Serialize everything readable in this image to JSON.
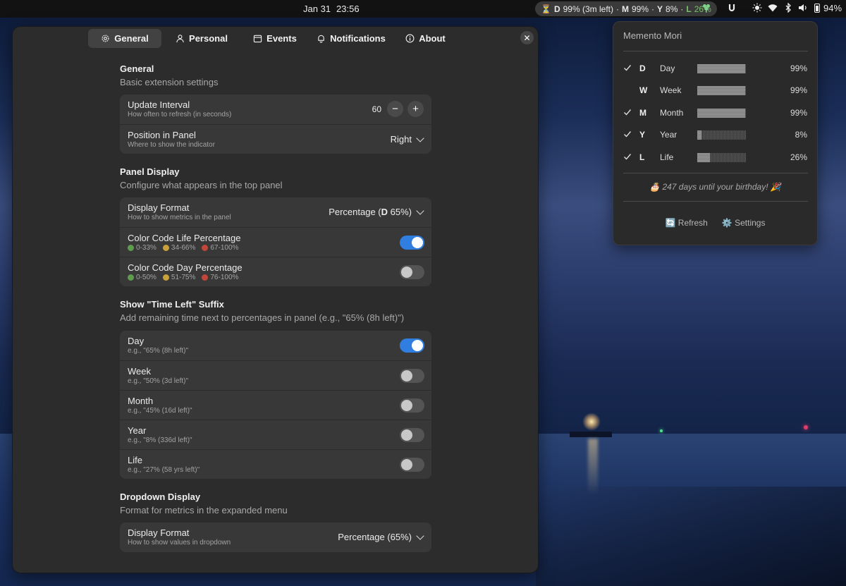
{
  "topbar": {
    "date": "Jan 31",
    "time": "23:56",
    "indicator": {
      "hourglass": "⏳",
      "d_letter": "D",
      "d_value": "99% (3m left)",
      "sep1": "·",
      "m_letter": "M",
      "m_value": "99%",
      "sep2": "·",
      "y_letter": "Y",
      "y_value": "8%",
      "sep3": "·",
      "l_letter": "L",
      "l_value": "26%"
    },
    "battery_level": "94%",
    "tray_icons": [
      "clover-icon",
      "u-app-icon",
      "brightness-icon",
      "wifi-icon",
      "bluetooth-icon",
      "volume-icon",
      "battery-icon"
    ]
  },
  "window": {
    "tabs": [
      {
        "label": "General",
        "icon": "gear-icon",
        "active": true
      },
      {
        "label": "Personal",
        "icon": "person-icon",
        "active": false
      },
      {
        "label": "Events",
        "icon": "calendar-icon",
        "active": false
      },
      {
        "label": "Notifications",
        "icon": "bell-icon",
        "active": false
      },
      {
        "label": "About",
        "icon": "info-icon",
        "active": false
      }
    ],
    "close_label": "✕",
    "general": {
      "title": "General",
      "subtitle": "Basic extension settings",
      "update_interval": {
        "title": "Update Interval",
        "subtitle": "How often to refresh (in seconds)",
        "value": "60",
        "minus": "−",
        "plus": "+"
      },
      "position": {
        "title": "Position in Panel",
        "subtitle": "Where to show the indicator",
        "value": "Right"
      }
    },
    "panel_display": {
      "title": "Panel Display",
      "subtitle": "Configure what appears in the top panel",
      "display_format": {
        "title": "Display Format",
        "subtitle": "How to show metrics in the panel",
        "value_prefix": "Percentage (",
        "value_bold": "D",
        "value_suffix": " 65%)"
      },
      "color_life": {
        "title": "Color Code Life Percentage",
        "ranges": [
          "0-33%",
          "34-66%",
          "67-100%"
        ],
        "enabled": true
      },
      "color_day": {
        "title": "Color Code Day Percentage",
        "ranges": [
          "0-50%",
          "51-75%",
          "76-100%"
        ],
        "enabled": false
      }
    },
    "time_left": {
      "title": "Show \"Time Left\" Suffix",
      "subtitle": "Add remaining time next to percentages in panel (e.g., \"65% (8h left)\")",
      "rows": [
        {
          "title": "Day",
          "example": "e.g., \"65% (8h left)\"",
          "enabled": true
        },
        {
          "title": "Week",
          "example": "e.g., \"50% (3d left)\"",
          "enabled": false
        },
        {
          "title": "Month",
          "example": "e.g., \"45% (16d left)\"",
          "enabled": false
        },
        {
          "title": "Year",
          "example": "e.g., \"8% (336d left)\"",
          "enabled": false
        },
        {
          "title": "Life",
          "example": "e.g., \"27% (58 yrs left)\"",
          "enabled": false
        }
      ]
    },
    "dropdown_display": {
      "title": "Dropdown Display",
      "subtitle": "Format for metrics in the expanded menu",
      "display_format": {
        "title": "Display Format",
        "subtitle": "How to show values in dropdown",
        "value": "Percentage (65%)"
      }
    }
  },
  "menu": {
    "title": "Memento Mori",
    "metrics": [
      {
        "letter": "D",
        "label": "Day",
        "percent": "99%",
        "fraction": 0.99,
        "checked": true
      },
      {
        "letter": "W",
        "label": "Week",
        "percent": "99%",
        "fraction": 0.99,
        "checked": false
      },
      {
        "letter": "M",
        "label": "Month",
        "percent": "99%",
        "fraction": 0.99,
        "checked": true
      },
      {
        "letter": "Y",
        "label": "Year",
        "percent": "8%",
        "fraction": 0.08,
        "checked": true
      },
      {
        "letter": "L",
        "label": "Life",
        "percent": "26%",
        "fraction": 0.26,
        "checked": true
      }
    ],
    "birthday": "🎂 247 days until your birthday! 🎉",
    "refresh_label": "🔄 Refresh",
    "settings_label": "⚙️ Settings"
  }
}
